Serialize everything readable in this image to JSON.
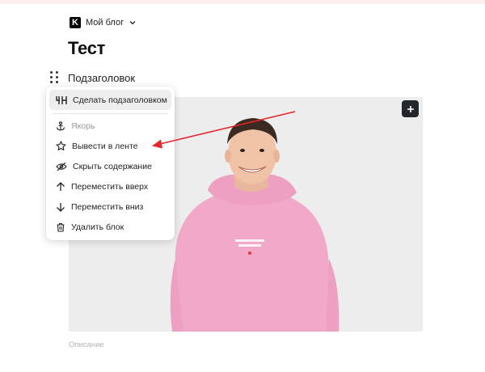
{
  "header": {
    "blog_name": "Мой блог",
    "logo_letter": "K"
  },
  "post": {
    "title": "Тест",
    "subheading": "Подзаголовок",
    "image_caption_placeholder": "Описание"
  },
  "block_menu": {
    "items": [
      {
        "label": "Сделать подзаголовком",
        "icon": "heading4-icon",
        "state": "highlighted"
      },
      {
        "label": "Якорь",
        "icon": "anchor-icon",
        "state": "disabled"
      },
      {
        "label": "Вывести в ленте",
        "icon": "star-icon",
        "state": "normal"
      },
      {
        "label": "Скрыть содержание",
        "icon": "eye-off-icon",
        "state": "normal"
      },
      {
        "label": "Переместить вверх",
        "icon": "arrow-up-icon",
        "state": "normal"
      },
      {
        "label": "Переместить вниз",
        "icon": "arrow-down-icon",
        "state": "normal"
      },
      {
        "label": "Удалить блок",
        "icon": "trash-icon",
        "state": "normal"
      }
    ]
  },
  "colors": {
    "annotation_arrow": "#e5262b",
    "hoodie": "#f2a9c9",
    "menu_highlight": "#eeeeee",
    "add_button": "#23272b"
  }
}
